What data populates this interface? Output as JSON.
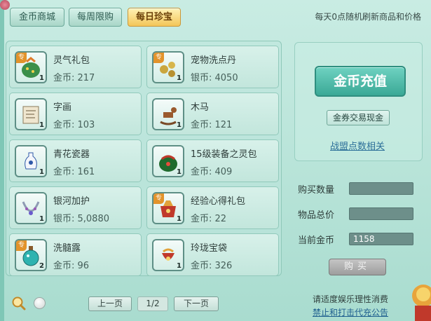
{
  "tabs": [
    {
      "label": "金币商城"
    },
    {
      "label": "每周限购"
    },
    {
      "label": "每日珍宝"
    }
  ],
  "refresh_note": "每天0点随机刷新商品和价格",
  "items": [
    {
      "name": "灵气礼包",
      "price": "金币: 217",
      "qty": "1",
      "tag": "专",
      "icon": "gift-bag-icon"
    },
    {
      "name": "宠物洗点丹",
      "price": "银币: 4050",
      "qty": "1",
      "tag": "专",
      "icon": "pills-icon"
    },
    {
      "name": "字画",
      "price": "金币: 103",
      "qty": "1",
      "tag": "",
      "icon": "scroll-icon"
    },
    {
      "name": "木马",
      "price": "金币: 121",
      "qty": "1",
      "tag": "",
      "icon": "rocking-horse-icon"
    },
    {
      "name": "青花瓷器",
      "price": "金币: 161",
      "qty": "1",
      "tag": "",
      "icon": "vase-icon"
    },
    {
      "name": "15级装备之灵包",
      "price": "金币: 409",
      "qty": "1",
      "tag": "",
      "icon": "green-bag-icon"
    },
    {
      "name": "银河加护",
      "price": "银币: 5,0880",
      "qty": "1",
      "tag": "",
      "icon": "necklace-icon"
    },
    {
      "name": "经验心得礼包",
      "price": "金币: 22",
      "qty": "1",
      "tag": "专",
      "icon": "red-bag-icon"
    },
    {
      "name": "洗髓露",
      "price": "金币: 96",
      "qty": "2",
      "tag": "专",
      "icon": "potion-icon"
    },
    {
      "name": "玲珑宝袋",
      "price": "金币: 326",
      "qty": "1",
      "tag": "",
      "icon": "pouch-icon"
    }
  ],
  "side": {
    "recharge_label": "金币充值",
    "exchange_label": "金券交易现金",
    "alliance_link": "战盟点数相关"
  },
  "form": {
    "qty_label": "购买数量",
    "qty_value": "",
    "total_label": "物品总价",
    "total_value": "",
    "gold_label": "当前金币",
    "gold_value": "1158",
    "buy_label": "购买"
  },
  "pager": {
    "prev_label": "上一页",
    "indicator": "1/2",
    "next_label": "下一页"
  },
  "notices": {
    "line1": "请适度娱乐理性消费",
    "line2": "禁止和打击代充公告"
  },
  "colors": {
    "accent": "#3aa896",
    "active_tab": "#f3c659",
    "link": "#2c6f99"
  }
}
